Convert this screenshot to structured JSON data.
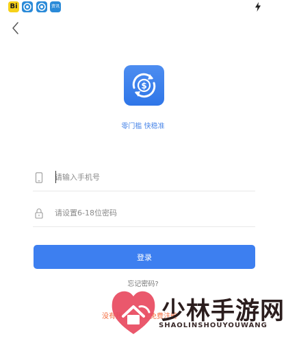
{
  "status_bar": {
    "app1_label": "Bi",
    "app4_label": "资讯"
  },
  "branding": {
    "slogan": "零门槛 快稳准"
  },
  "login_form": {
    "phone_placeholder": "请输入手机号",
    "password_placeholder": "请设置6-18位密码",
    "login_button": "登录",
    "forgot_password": "忘记密码?",
    "register_link": "没有账号？马上免费注册"
  },
  "watermark": {
    "title": "少林手游网",
    "subtitle": "SHAOLINSHOUYOUWANG"
  },
  "colors": {
    "accent": "#3d7ff0",
    "logo_bg": "#2f76e8",
    "slogan": "#4a86e8",
    "register_link": "#f36a3c",
    "watermark_heart": "#e84a5f"
  }
}
